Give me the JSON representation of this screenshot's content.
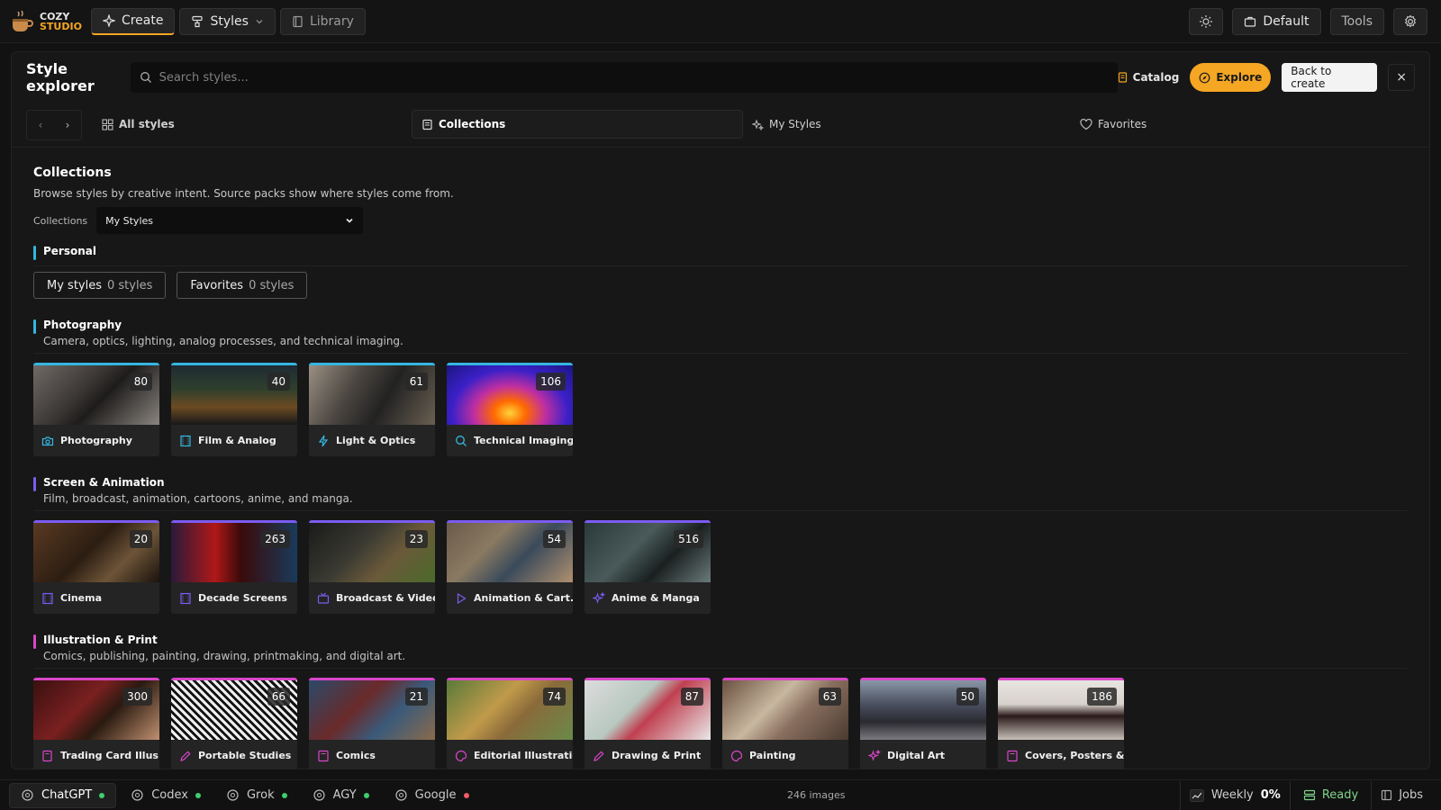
{
  "app": {
    "logo_line1": "COZY",
    "logo_line2": "STUDIO"
  },
  "topbar": {
    "create": "Create",
    "styles": "Styles",
    "library": "Library",
    "profile": "Default",
    "tools": "Tools"
  },
  "explorer": {
    "title": "Style explorer",
    "search_placeholder": "Search styles...",
    "catalog": "Catalog",
    "explore": "Explore",
    "back": "Back to create",
    "close": "×"
  },
  "tabs": {
    "all": "All styles",
    "collections": "Collections",
    "mine": "My Styles",
    "favorites": "Favorites"
  },
  "collections": {
    "title": "Collections",
    "description": "Browse styles by creative intent. Source packs show where styles come from.",
    "select_label": "Collections",
    "select_value": "My Styles"
  },
  "personal": {
    "title": "Personal",
    "pills": [
      {
        "label": "My styles",
        "count": "0 styles"
      },
      {
        "label": "Favorites",
        "count": "0 styles"
      }
    ]
  },
  "sections": [
    {
      "title": "Photography",
      "description": "Camera, optics, lighting, analog processes, and technical imaging.",
      "color": "#35b6e0",
      "cards": [
        {
          "label": "Photography",
          "count": "80",
          "icon": "camera-icon"
        },
        {
          "label": "Film & Analog",
          "count": "40",
          "icon": "film-icon"
        },
        {
          "label": "Light & Optics",
          "count": "61",
          "icon": "bolt-icon"
        },
        {
          "label": "Technical Imaging",
          "count": "106",
          "icon": "magnifier-icon"
        }
      ]
    },
    {
      "title": "Screen & Animation",
      "description": "Film, broadcast, animation, cartoons, anime, and manga.",
      "color": "#7b5cf0",
      "cards": [
        {
          "label": "Cinema",
          "count": "20",
          "icon": "film-icon"
        },
        {
          "label": "Decade Screens",
          "count": "263",
          "icon": "film-icon"
        },
        {
          "label": "Broadcast & Video",
          "count": "23",
          "icon": "tv-icon"
        },
        {
          "label": "Animation & Cart...",
          "count": "54",
          "icon": "play-icon"
        },
        {
          "label": "Anime & Manga",
          "count": "516",
          "icon": "sparkle-icon"
        }
      ]
    },
    {
      "title": "Illustration & Print",
      "description": "Comics, publishing, painting, drawing, printmaking, and digital art.",
      "color": "#d946c9",
      "cards": [
        {
          "label": "Trading Card Illus...",
          "count": "300",
          "icon": "card-icon"
        },
        {
          "label": "Portable Studies",
          "count": "66",
          "icon": "pencil-icon"
        },
        {
          "label": "Comics",
          "count": "21",
          "icon": "book-icon"
        },
        {
          "label": "Editorial Illustration",
          "count": "74",
          "icon": "palette-icon"
        },
        {
          "label": "Drawing & Print",
          "count": "87",
          "icon": "pencil-icon"
        },
        {
          "label": "Painting",
          "count": "63",
          "icon": "palette-icon"
        },
        {
          "label": "Digital Art",
          "count": "50",
          "icon": "sparkle-icon"
        },
        {
          "label": "Covers, Posters & ...",
          "count": "186",
          "icon": "book-icon"
        }
      ]
    }
  ],
  "statusbar": {
    "providers": [
      {
        "name": "ChatGPT",
        "dot": "#3ecf6e"
      },
      {
        "name": "Codex",
        "dot": "#3ecf6e"
      },
      {
        "name": "Grok",
        "dot": "#3ecf6e"
      },
      {
        "name": "AGY",
        "dot": "#3ecf6e"
      },
      {
        "name": "Google",
        "dot": "#f05b6a"
      }
    ],
    "image_count": "246 images",
    "weekly": "Weekly",
    "weekly_pct": "0%",
    "ready": "Ready",
    "jobs": "Jobs"
  },
  "colors": {
    "accent": "#f5a623",
    "photography": "#35b6e0",
    "screen": "#7b5cf0",
    "illustration": "#d946c9"
  }
}
